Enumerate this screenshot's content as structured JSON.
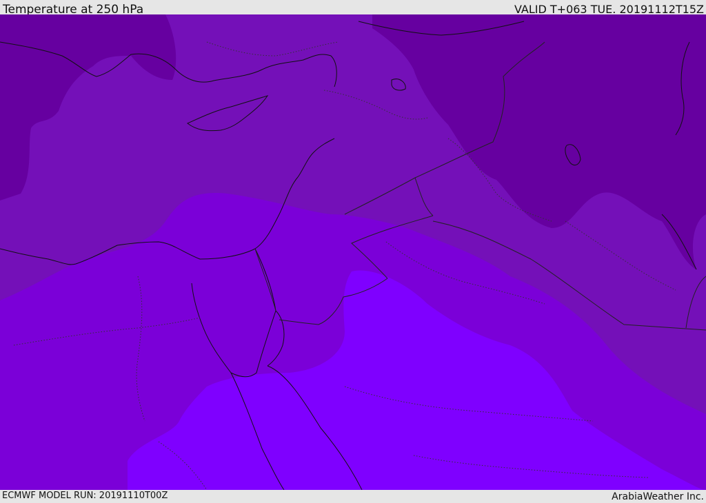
{
  "header": {
    "title": "Temperature at 250 hPa",
    "valid_time": "VALID T+063 TUE. 20191112T15Z"
  },
  "footer": {
    "model_run": "ECMWF MODEL RUN: 20191110T00Z",
    "credit": "ArabiaWeather Inc."
  },
  "map": {
    "field": "temperature",
    "pressure_level_hpa": 250,
    "colors": {
      "darkest": "#6600a0",
      "dark": "#7410b8",
      "mid": "#7b00d8",
      "light": "#7f00ff",
      "coast": "#111111",
      "border": "#222222"
    }
  }
}
